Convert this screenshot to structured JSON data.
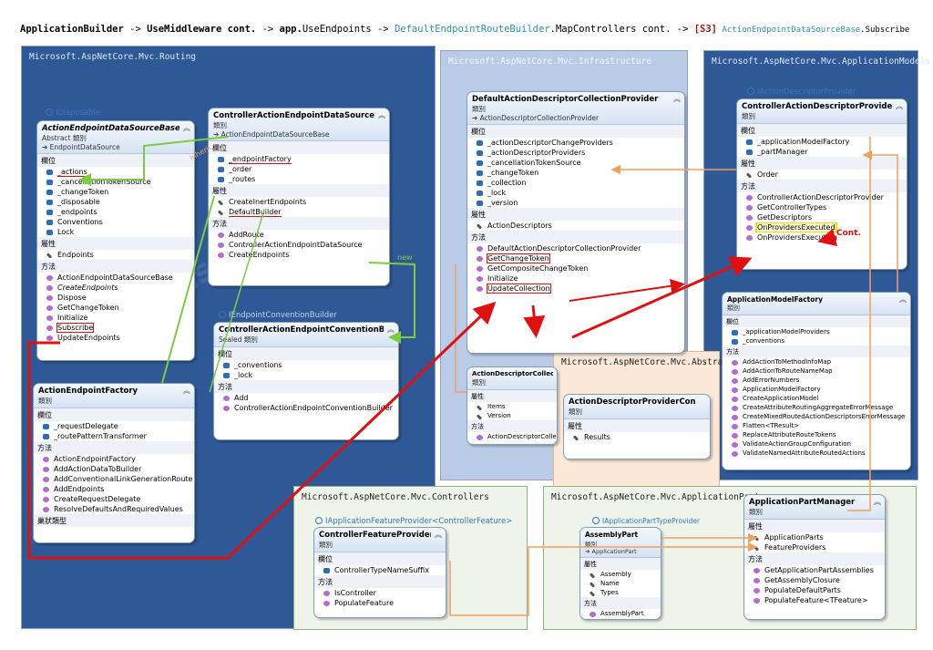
{
  "header": {
    "p1": "ApplicationBuilder",
    "a1": " -> ",
    "p2": "UseMiddleware",
    "p3": " cont.",
    "a2": "  ->  ",
    "p4": "app.",
    "p5": "UseEndpoints",
    "a3": "  ->  ",
    "p6": "DefaultEndpointRouteBuilder",
    "p7": ".MapControllers cont.",
    "a4": "  ->  ",
    "p8": "[S3]",
    "p9": " ActionEndpointDataSourceBase",
    "p10": ".Subscribe"
  },
  "namespaces": {
    "routing": "Microsoft.AspNetCore.Mvc.Routing",
    "infrastructure": "Microsoft.AspNetCore.Mvc.Infrastructure",
    "appmodels": "Microsoft.AspNetCore.Mvc.ApplicationModels",
    "abstraction": "Microsoft.AspNetCore.Mvc.Abstraction",
    "controllers": "Microsoft.AspNetCore.Mvc.Controllers",
    "appparts": "Microsoft.AspNetCore.Mvc.ApplicationParts"
  },
  "interfaces": {
    "idisposable": "IDisposable",
    "iendpointconv": "IEndpointConventionBuilder",
    "iactiondescprov": "IActionDescriptorProvider",
    "iappfeatprov": "IApplicationFeatureProvider<ControllerFeature>",
    "iappparttype": "IApplicationPartTypeProvider"
  },
  "labels": {
    "inherit": "Inherit",
    "new": "new",
    "cont": "Cont."
  },
  "boxes": {
    "aeds": {
      "name": "ActionEndpointDataSourceBase",
      "sub": "Abstract 類別",
      "base": "➔ EndpointDataSource",
      "sections": [
        {
          "title": "欄位",
          "members": [
            "_actions",
            "_cancellationTokenSource",
            "_changeToken",
            "_disposable",
            "_endpoints",
            "Conventions",
            "Lock"
          ]
        },
        {
          "title": "屬性",
          "members": [
            "Endpoints"
          ]
        },
        {
          "title": "方法",
          "members": [
            "ActionEndpointDataSourceBase",
            "CreateEndpoints",
            "Dispose",
            "GetChangeToken",
            "Initialize",
            "Subscribe",
            "UpdateEndpoints"
          ]
        }
      ]
    },
    "caeds": {
      "name": "ControllerActionEndpointDataSource",
      "sub": "類別",
      "base": "➔ ActionEndpointDataSourceBase",
      "sections": [
        {
          "title": "欄位",
          "members": [
            "_endpointFactory",
            "_order",
            "_routes"
          ]
        },
        {
          "title": "屬性",
          "members": [
            "CreateInertEndpoints",
            "DefaultBuilder"
          ]
        },
        {
          "title": "方法",
          "members": [
            "AddRoute",
            "ControllerActionEndpointDataSource",
            "CreateEndpoints"
          ]
        }
      ]
    },
    "caecb": {
      "name": "ControllerActionEndpointConventionBuilder",
      "sub": "Sealed 類別",
      "sections": [
        {
          "title": "欄位",
          "members": [
            "_conventions",
            "_lock"
          ]
        },
        {
          "title": "方法",
          "members": [
            "Add",
            "ControllerActionEndpointConventionBuilder"
          ]
        }
      ]
    },
    "aef": {
      "name": "ActionEndpointFactory",
      "sub": "類別",
      "sections": [
        {
          "title": "欄位",
          "members": [
            "_requestDelegate",
            "_routePatternTransformer"
          ]
        },
        {
          "title": "方法",
          "members": [
            "ActionEndpointFactory",
            "AddActionDataToBuilder",
            "AddConventionalLinkGenerationRoute",
            "AddEndpoints",
            "CreateRequestDelegate",
            "ResolveDefaultsAndRequiredValues"
          ]
        },
        {
          "title": "巢狀類型",
          "members": []
        }
      ]
    },
    "dadcp": {
      "name": "DefaultActionDescriptorCollectionProvider",
      "sub": "類別",
      "base": "➔ ActionDescriptorCollectionProvider",
      "sections": [
        {
          "title": "欄位",
          "members": [
            "_actionDescriptorChangeProviders",
            "_actionDescriptorProviders",
            "_cancellationTokenSource",
            "_changeToken",
            "_collection",
            "_lock",
            "_version"
          ]
        },
        {
          "title": "屬性",
          "members": [
            "ActionDescriptors"
          ]
        },
        {
          "title": "方法",
          "members": [
            "DefaultActionDescriptorCollectionProvider",
            "GetChangeToken",
            "GetCompositeChangeToken",
            "Initialize",
            "UpdateCollection"
          ]
        }
      ]
    },
    "adc": {
      "name": "ActionDescriptorCollection",
      "sub": "類別",
      "sections": [
        {
          "title": "屬性",
          "members": [
            "Items",
            "Version"
          ]
        },
        {
          "title": "方法",
          "members": [
            "ActionDescriptorCollec..."
          ]
        }
      ]
    },
    "cadp": {
      "name": "ControllerActionDescriptorProvider",
      "sub": "類別",
      "sections": [
        {
          "title": "欄位",
          "members": [
            "_applicationModelFactory",
            "_partManager"
          ]
        },
        {
          "title": "屬性",
          "members": [
            "Order"
          ]
        },
        {
          "title": "方法",
          "members": [
            "ControllerActionDescriptorProvider",
            "GetControllerTypes",
            "GetDescriptors",
            "OnProvidersExecuted",
            "OnProvidersExecuting"
          ]
        }
      ]
    },
    "amf": {
      "name": "ApplicationModelFactory",
      "sub": "類別",
      "sections": [
        {
          "title": "欄位",
          "members": [
            "_applicationModelProviders",
            "_conventions"
          ]
        },
        {
          "title": "方法",
          "members": [
            "AddActionToMethodInfoMap",
            "AddActionToRouteNameMap",
            "AddErrorNumbers",
            "ApplicationModelFactory",
            "CreateApplicationModel",
            "CreateAttributeRoutingAggregateErrorMessage",
            "CreateMixedRoutedActionDescriptorsErrorMessage",
            "Flatten<TResult>",
            "ReplaceAttributeRouteTokens",
            "ValidateActionGroupConfiguration",
            "ValidateNamedAttributeRoutedActions"
          ]
        }
      ]
    },
    "adpc": {
      "name": "ActionDescriptorProviderContext",
      "sub": "類別",
      "sections": [
        {
          "title": "屬性",
          "members": [
            "Results"
          ]
        }
      ]
    },
    "cfp": {
      "name": "ControllerFeatureProvider",
      "sub": "類別",
      "sections": [
        {
          "title": "欄位",
          "members": [
            "ControllerTypeNameSuffix"
          ]
        },
        {
          "title": "方法",
          "members": [
            "IsController",
            "PopulateFeature"
          ]
        }
      ]
    },
    "ap": {
      "name": "AssemblyPart",
      "sub": "類別",
      "base": "➔ ApplicationPart",
      "sections": [
        {
          "title": "屬性",
          "members": [
            "Assembly",
            "Name",
            "Types"
          ]
        },
        {
          "title": "方法",
          "members": [
            "AssemblyPart"
          ]
        }
      ]
    },
    "apm": {
      "name": "ApplicationPartManager",
      "sub": "類別",
      "sections": [
        {
          "title": "屬性",
          "members": [
            "ApplicationParts",
            "FeatureProviders"
          ]
        },
        {
          "title": "方法",
          "members": [
            "GetApplicationPartAssemblies",
            "GetAssemblyClosure",
            "PopulateDefaultParts",
            "PopulateFeature<TFeature>"
          ]
        }
      ]
    }
  },
  "colors": {
    "highlight_red": "#e01010",
    "arrow_orange": "#f0a060",
    "arrow_green": "#7ccc40",
    "ns_blue": "#2f5996"
  }
}
